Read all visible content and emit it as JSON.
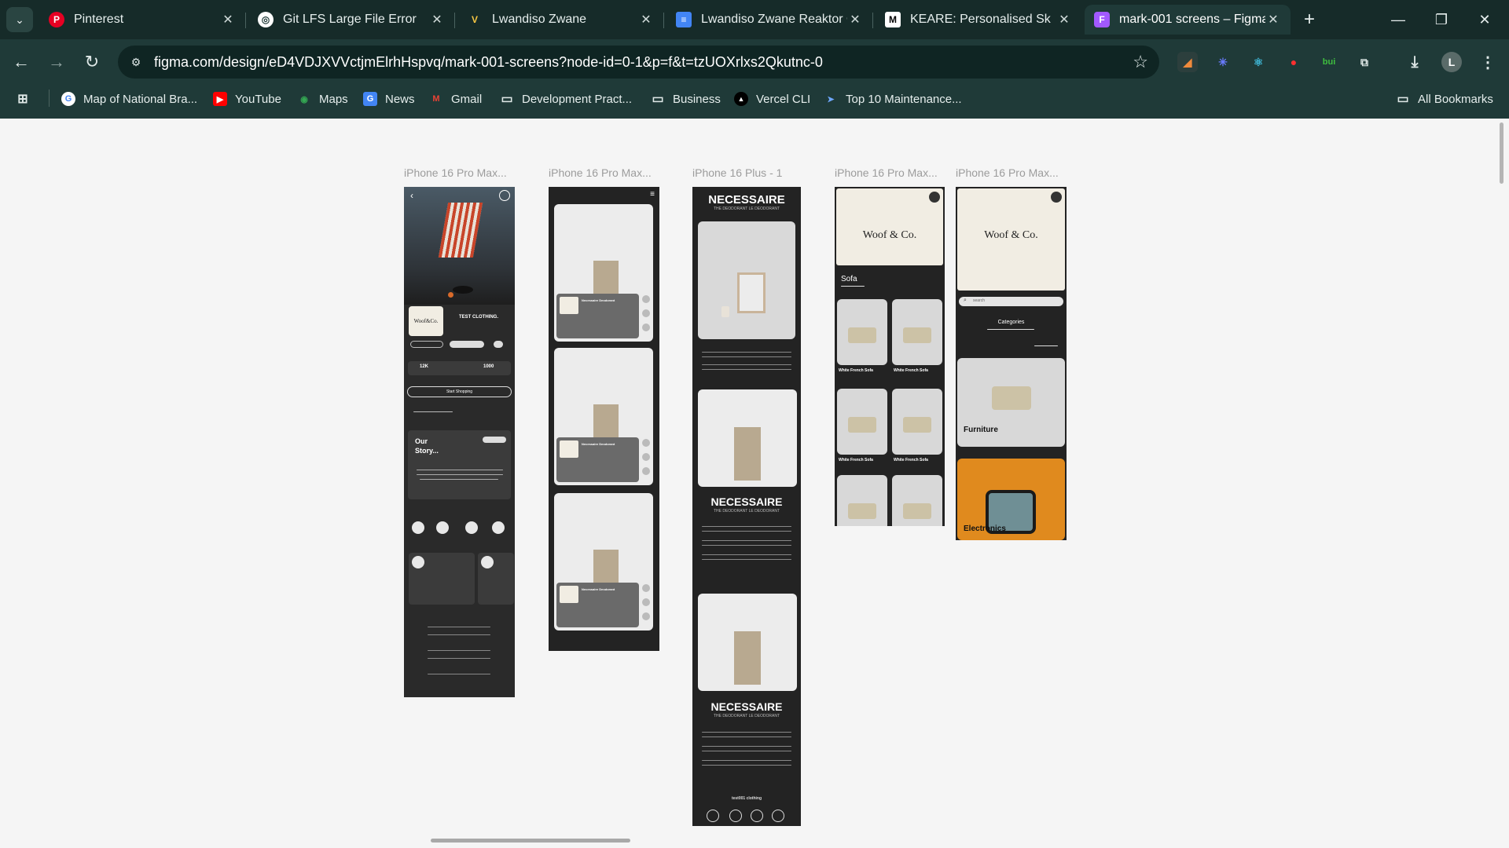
{
  "browser": {
    "tabs": [
      {
        "title": "Pinterest",
        "icon": "pinterest-icon",
        "color": "#e60023",
        "glyph": "P"
      },
      {
        "title": "Git LFS Large File Error",
        "icon": "openai-icon",
        "color": "#ffffff",
        "glyph": "◎"
      },
      {
        "title": "Lwandiso Zwane",
        "icon": "vercel-v-icon",
        "color": "#6d5dfc",
        "glyph": "V"
      },
      {
        "title": "Lwandiso Zwane Reaktor C",
        "icon": "google-docs-icon",
        "color": "#4285f4",
        "glyph": "≡"
      },
      {
        "title": "KEARE: Personalised Sk",
        "icon": "medium-icon",
        "color": "#ffffff",
        "glyph": "M"
      },
      {
        "title": "mark-001 screens – Figma",
        "icon": "figma-icon",
        "color": "#a259ff",
        "glyph": "F"
      }
    ],
    "active_tab": 5,
    "url": "figma.com/design/eD4VDJXVVctjmElrhHspvq/mark-001-screens?node-id=0-1&p=f&t=tzUOXrlxs2Qkutnc-0",
    "bookmarks": [
      {
        "label": "Map of National Bra...",
        "icon": "google-icon",
        "color": "#4285f4",
        "glyph": "G"
      },
      {
        "label": "YouTube",
        "icon": "youtube-icon",
        "color": "#ff0000",
        "glyph": "▶"
      },
      {
        "label": "Maps",
        "icon": "maps-icon",
        "color": "#34a853",
        "glyph": "◉"
      },
      {
        "label": "News",
        "icon": "news-icon",
        "color": "#4285f4",
        "glyph": "G"
      },
      {
        "label": "Gmail",
        "icon": "gmail-icon",
        "color": "#ea4335",
        "glyph": "M"
      },
      {
        "label": "Development Pract...",
        "icon": "folder-icon",
        "color": "transparent",
        "glyph": "▭"
      },
      {
        "label": "Business",
        "icon": "folder-icon",
        "color": "transparent",
        "glyph": "▭"
      },
      {
        "label": "Vercel CLI",
        "icon": "vercel-icon",
        "color": "#000000",
        "glyph": "▲"
      },
      {
        "label": "Top 10 Maintenance...",
        "icon": "send-icon",
        "color": "transparent",
        "glyph": "➤"
      }
    ],
    "all_bookmarks": "All Bookmarks",
    "profile_initial": "L"
  },
  "figma": {
    "frames": [
      {
        "label": "iPhone 16 Pro Max..."
      },
      {
        "label": "iPhone 16 Pro Max..."
      },
      {
        "label": "iPhone 16 Plus - 1"
      },
      {
        "label": "iPhone 16 Pro Max..."
      },
      {
        "label": "iPhone 16 Pro Max..."
      }
    ],
    "frame1": {
      "brand": "Woof&Co.",
      "headline": "TEST CLOTHING.",
      "stat_a": "12K",
      "stat_b": "1000",
      "cta": "Start Shopping",
      "story": "Our Story..."
    },
    "frame2": {
      "product": "Necessaire Deodorant",
      "brand_mini": "Woof&Co."
    },
    "frame3": {
      "title": "NECESSAIRE",
      "subtitle": "THE DEODORANT LE DEODORANT",
      "footer": "test001 clothing"
    },
    "frame4": {
      "brand": "Woof & Co.",
      "category": "Sofa",
      "item": "White French Sofa"
    },
    "frame5": {
      "brand": "Woof & Co.",
      "search_placeholder": "search",
      "categories_title": "Categories",
      "cat1": "Furniture",
      "cat2": "Electronics"
    }
  }
}
